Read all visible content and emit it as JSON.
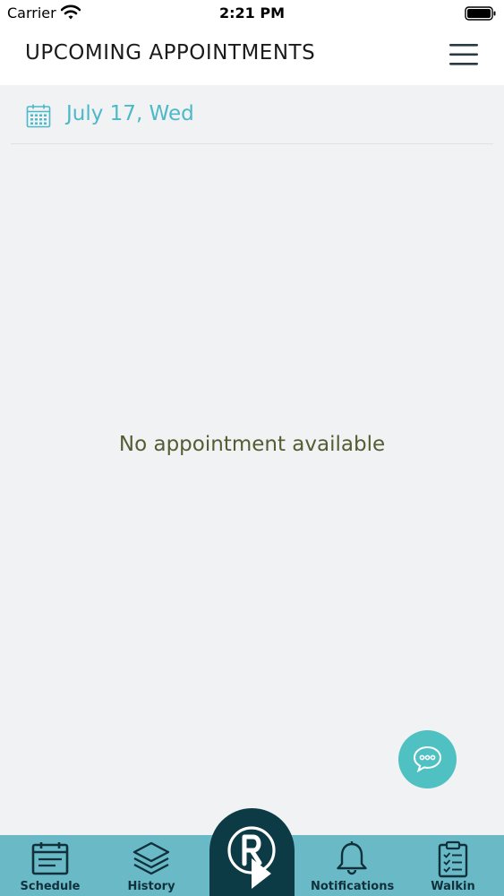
{
  "status_bar": {
    "carrier": "Carrier",
    "time": "2:21 PM",
    "icons": [
      "wifi-icon",
      "battery-icon"
    ]
  },
  "header": {
    "title": "UPCOMING APPOINTMENTS",
    "menu_icon": "hamburger-menu-icon"
  },
  "date_row": {
    "icon": "calendar-icon",
    "date": "July 17, Wed"
  },
  "main": {
    "empty_message": "No appointment available"
  },
  "chat_button": {
    "icon": "chat-bubble-icon"
  },
  "tab_bar": {
    "tabs": [
      {
        "label": "Schedule",
        "icon": "calendar-icon"
      },
      {
        "label": "History",
        "icon": "layers-icon"
      },
      {
        "label": "",
        "icon": "logo-r-arrow-icon"
      },
      {
        "label": "Notifications",
        "icon": "bell-icon"
      },
      {
        "label": "Walkin",
        "icon": "clipboard-checklist-icon"
      }
    ]
  },
  "colors": {
    "accent": "#4cb8c8",
    "tab_bar": "#6ab9c6",
    "center_tab": "#0d3b45",
    "empty_text": "#535d33",
    "chat_button": "#4fc1c3"
  }
}
